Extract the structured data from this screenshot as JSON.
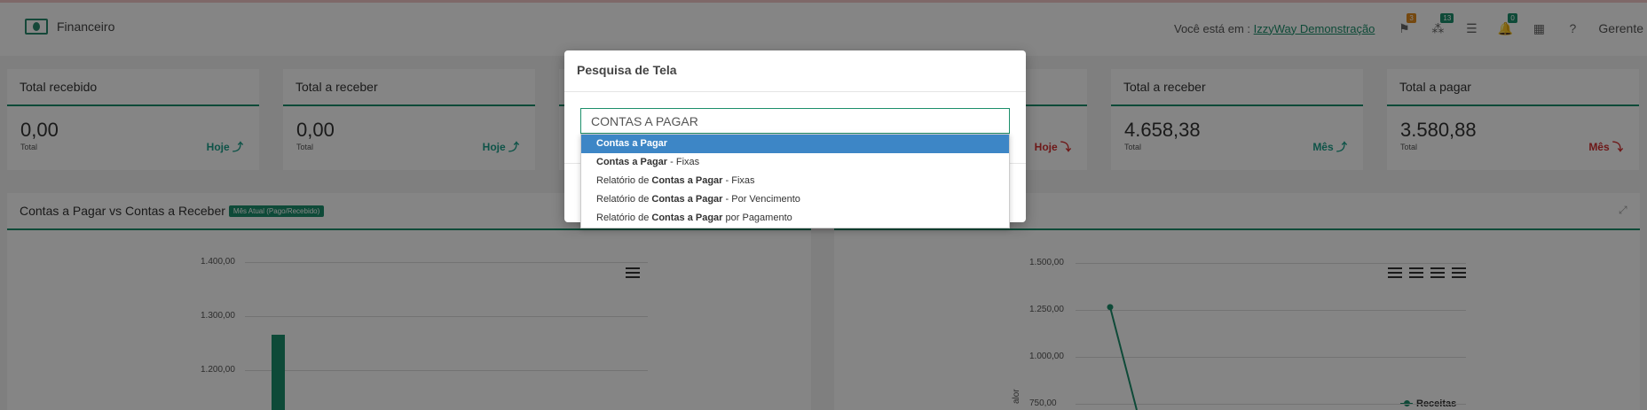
{
  "header": {
    "brand_title": "Financeiro",
    "where_label": "Você está em :",
    "company": "IzzyWay Demonstração",
    "badges": {
      "a": "3",
      "b": "13",
      "c": "0"
    },
    "user": "Gerente"
  },
  "cards": [
    {
      "title": "Total recebido",
      "value": "0,00",
      "sub": "Total",
      "period": "Hoje ⤴",
      "trend": "up"
    },
    {
      "title": "Total a receber",
      "value": "0,00",
      "sub": "Total",
      "period": "Hoje ⤴",
      "trend": "up"
    },
    {
      "title": "",
      "value": "",
      "sub": "",
      "period": "",
      "trend": ""
    },
    {
      "title": "",
      "value": "",
      "sub": "",
      "period": "Hoje ⤵",
      "trend": "down"
    },
    {
      "title": "Total a receber",
      "value": "4.658,38",
      "sub": "Total",
      "period": "Mês ⤴",
      "trend": "up"
    },
    {
      "title": "Total a pagar",
      "value": "3.580,88",
      "sub": "Total",
      "period": "Mês ⤵",
      "trend": "down"
    }
  ],
  "left_panel": {
    "title": "Contas a Pagar vs Contas a Receber",
    "tag": "Mês Atual (Pago/Recebido)",
    "y_ticks": [
      "1.400,00",
      "1.300,00",
      "1.200,00"
    ]
  },
  "right_panel": {
    "y_ticks": [
      "1.500,00",
      "1.250,00",
      "1.000,00",
      "750,00"
    ],
    "ylabel": "alor",
    "legend": "Receitas"
  },
  "modal": {
    "title": "Pesquisa de Tela",
    "input_value": "CONTAS A PAGAR",
    "items": [
      {
        "pre": "",
        "bold": "Contas a Pagar",
        "post": ""
      },
      {
        "pre": "",
        "bold": "Contas a Pagar",
        "post": " - Fixas"
      },
      {
        "pre": "Relatório de ",
        "bold": "Contas a Pagar",
        "post": " - Fixas"
      },
      {
        "pre": "Relatório de ",
        "bold": "Contas a Pagar",
        "post": " - Por Vencimento"
      },
      {
        "pre": "Relatório de ",
        "bold": "Contas a Pagar",
        "post": " por Pagamento"
      }
    ]
  },
  "colors": {
    "accent": "#1c8f6b",
    "highlight": "#3d86c6",
    "down": "#d32f2f"
  },
  "chart_data": [
    {
      "type": "bar",
      "title": "Contas a Pagar vs Contas a Receber",
      "ylim": [
        1150,
        1450
      ],
      "y_ticks": [
        1400,
        1300,
        1200
      ],
      "values": [
        1265
      ]
    },
    {
      "type": "line",
      "ylim": [
        700,
        1550
      ],
      "y_ticks": [
        1500,
        1250,
        1000,
        750
      ],
      "series": [
        {
          "name": "Receitas",
          "values": [
            1265,
            700
          ]
        }
      ]
    }
  ]
}
